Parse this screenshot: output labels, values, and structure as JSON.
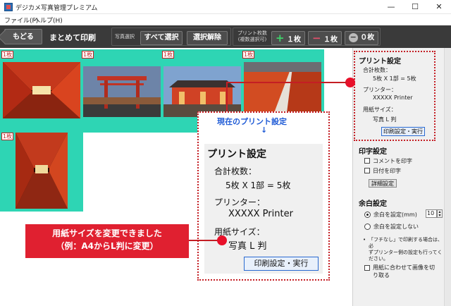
{
  "window": {
    "title": "デジカメ写真管理プレミアム",
    "minimize_glyph": "—",
    "maximize_glyph": "☐",
    "close_glyph": "✕"
  },
  "menu": {
    "file": "ファイル(F)",
    "help": "ヘルプ(H)"
  },
  "toolbar": {
    "back": "もどる",
    "title": "まとめて印刷",
    "select_label": "写真選択",
    "select_all": "すべて選択",
    "deselect": "選択解除",
    "print_count_label_1": "プリント枚数",
    "print_count_label_2": "(複数選択可)",
    "plus_one": "１枚",
    "minus_one": "１枚",
    "zero": "０枚"
  },
  "thumbnails": [
    {
      "count": "1枚"
    },
    {
      "count": "1枚"
    },
    {
      "count": "1枚"
    },
    {
      "count": "1枚"
    },
    {
      "count": "1枚"
    }
  ],
  "sidebar": {
    "print_settings": {
      "title": "プリント設定",
      "total_label": "合計枚数：",
      "total_value": "5枚 X 1部 = 5枚",
      "printer_label": "プリンター：",
      "printer_value": "XXXXX Printer",
      "paper_label": "用紙サイズ：",
      "paper_value": "写真 L 判",
      "button": "印刷設定・実行"
    },
    "imprint": {
      "title": "印字設定",
      "comment": "コメントを印字",
      "date": "日付を印字",
      "detail_button": "詳細設定"
    },
    "margin": {
      "title": "余白設定",
      "set": "余白を設定(mm)",
      "set_value": "10",
      "none": "余白を設定しない",
      "note_1": "「フチなし」で印刷する場合は、必",
      "note_2": "ずプリンター側の設定も行ってください。",
      "fit_1": "用紙に合わせて画像を切",
      "fit_2": "り取る"
    }
  },
  "callout": {
    "caption": "現在のプリント設定",
    "arrow": "↓",
    "title": "プリント設定",
    "total_label": "合計枚数：",
    "total_value": "5枚 X 1部 = 5枚",
    "printer_label": "プリンター：",
    "printer_value": "XXXXX Printer",
    "paper_label": "用紙サイズ：",
    "paper_value": "写真 L 判",
    "button": "印刷設定・実行"
  },
  "banner": {
    "line1": "用紙サイズを変更できました",
    "line2": "（例：A4からL判に変更）"
  },
  "colors": {
    "toolbar_bg": "#3a3a3a",
    "selection_green": "#2ed5b4",
    "callout_red": "#c41e24",
    "banner_red": "#e02030",
    "button_blue": "#2a6ad0"
  }
}
